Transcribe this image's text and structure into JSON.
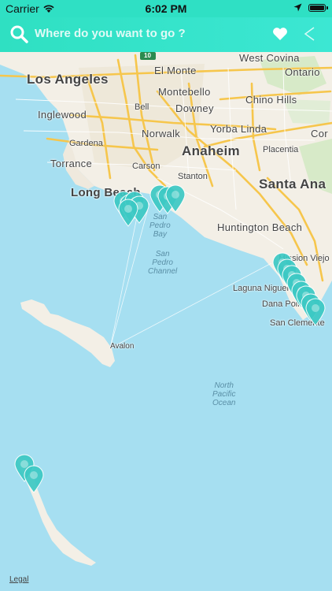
{
  "status_bar": {
    "carrier": "Carrier",
    "time": "6:02 PM"
  },
  "nav": {
    "search_placeholder": "Where do you want to go ?",
    "icons": [
      "search-icon",
      "heart-icon",
      "back-chevron-icon"
    ]
  },
  "colors": {
    "accent": "#33e2c8",
    "pin": "#3cc9c4",
    "water": "#a6dff1",
    "land": "#f3efe6"
  },
  "map": {
    "city_labels": {
      "los_angeles": "Los Angeles",
      "anaheim": "Anaheim",
      "santa_ana": "Santa Ana",
      "long_beach": "Long Beach",
      "huntington_beach": "Huntington Beach"
    },
    "town_labels": {
      "west_covina": "West Covina",
      "el_monte": "El Monte",
      "ontario": "Ontario",
      "montebello": "Montebello",
      "chino_hills": "Chino Hills",
      "bell": "Bell",
      "downey": "Downey",
      "inglewood": "Inglewood",
      "yorba_linda": "Yorba Linda",
      "norwalk": "Norwalk",
      "gardena": "Gardena",
      "placentia": "Placentia",
      "cor": "Cor",
      "torrance": "Torrance",
      "carson": "Carson",
      "stanton": "Stanton",
      "mission_viejo": "Mission Viejo",
      "laguna_niguel": "Laguna Niguel",
      "dana_point": "Dana Point",
      "san_clemente": "San Clemente",
      "avalon": "Avalon"
    },
    "water_labels": {
      "san_pedro_bay": [
        "San",
        "Pedro",
        "Bay"
      ],
      "san_pedro_channel": [
        "San",
        "Pedro",
        "Channel"
      ],
      "north_pacific_ocean": [
        "North",
        "Pacific",
        "Ocean"
      ]
    },
    "legal": "Legal",
    "highway_shield": "10"
  }
}
